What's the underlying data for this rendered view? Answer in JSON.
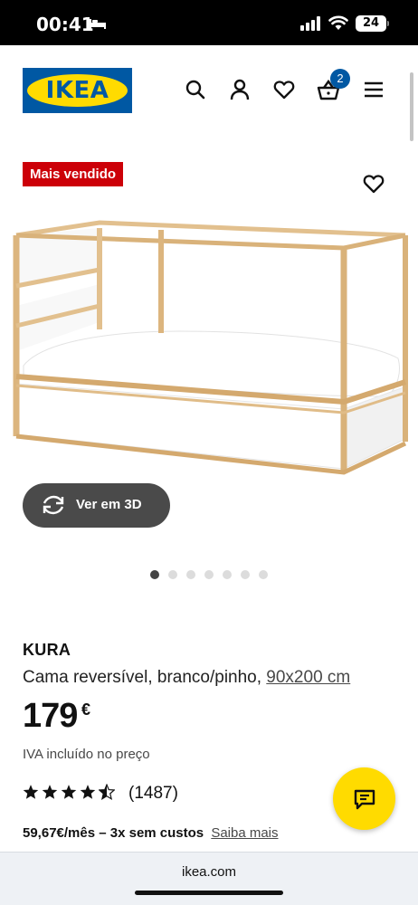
{
  "status_bar": {
    "time": "00:41",
    "battery": "24"
  },
  "header": {
    "logo_text": "IKEA",
    "cart_count": "2",
    "icons": [
      "search-icon",
      "account-icon",
      "heart-icon",
      "basket-icon",
      "menu-icon"
    ]
  },
  "product": {
    "badge": "Mais vendido",
    "view_3d_label": "Ver em 3D",
    "image_count": 7,
    "active_image": 1,
    "name": "KURA",
    "description": "Cama reversível, branco/pinho,",
    "size": "90x200 cm",
    "price": "179",
    "currency": "€",
    "vat_note": "IVA incluído no preço",
    "rating": 4.5,
    "reviews": "(1487)",
    "installment": "59,67€/mês – 3x sem custos",
    "installment_link": "Saiba mais"
  },
  "browser": {
    "url": "ikea.com"
  },
  "colors": {
    "brand_blue": "#0058a3",
    "brand_yellow": "#ffdb00",
    "badge_red": "#cc0008"
  }
}
